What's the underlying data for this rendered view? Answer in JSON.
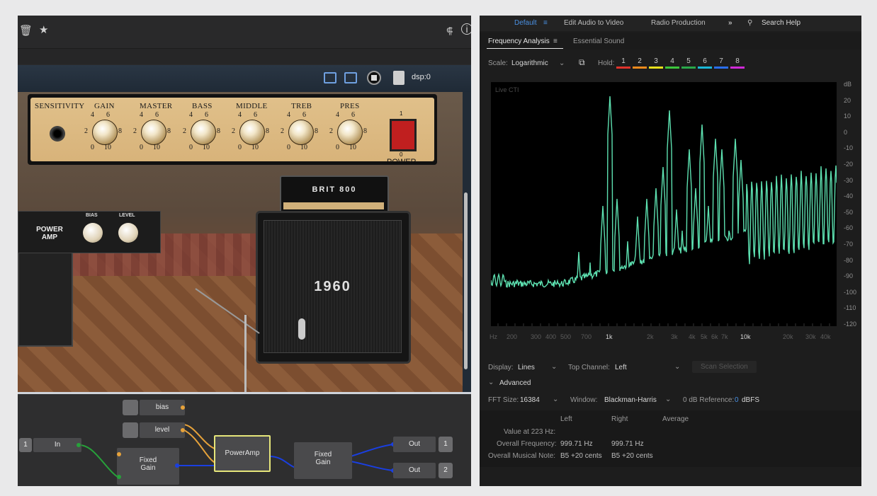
{
  "left": {
    "plugin": {
      "dsp_label": "dsp:0"
    },
    "amp": {
      "knob_labels": [
        "SENSITIVITY",
        "GAIN",
        "MASTER",
        "BASS",
        "MIDDLE",
        "TREB",
        "PRES"
      ],
      "scale": {
        "low": "0",
        "mid_low": "2",
        "top_left": "4",
        "top_right": "6",
        "mid_high": "8",
        "high": "10"
      },
      "power_label": "POWER",
      "power_on": "1",
      "power_off": "0"
    },
    "brit_label": "BRIT 800",
    "cab_label": "1960",
    "power_amp": {
      "title_line1": "POWER",
      "title_line2": "AMP",
      "bias": "BIAS",
      "level": "LEVEL"
    },
    "graph": {
      "in_label": "In",
      "in_badge": "1",
      "bias_label": "bias",
      "level_label": "level",
      "fixed_gain_1": "Fixed\nGain",
      "poweramp": "PowerAmp",
      "fixed_gain_2": "Fixed\nGain",
      "out1_label": "Out",
      "out1_badge": "1",
      "out2_label": "Out",
      "out2_badge": "2"
    }
  },
  "right": {
    "workspaces": [
      "Default",
      "Edit Audio to Video",
      "Radio Production"
    ],
    "search_placeholder": "Search Help",
    "tabs": {
      "active": "Frequency Analysis",
      "other": "Essential Sound"
    },
    "scale_label": "Scale:",
    "scale_value": "Logarithmic",
    "hold_label": "Hold:",
    "hold_slots": [
      {
        "n": "1",
        "color": "#e0332c"
      },
      {
        "n": "2",
        "color": "#f08a1c"
      },
      {
        "n": "3",
        "color": "#e8e01c"
      },
      {
        "n": "4",
        "color": "#3cc63c"
      },
      {
        "n": "5",
        "color": "#2aa84a"
      },
      {
        "n": "6",
        "color": "#1ab8d8"
      },
      {
        "n": "7",
        "color": "#2a6ef0"
      },
      {
        "n": "8",
        "color": "#d02ad8"
      }
    ],
    "graph_title": "Live CTI",
    "db_labels": [
      "dB",
      "20",
      "10",
      "0",
      "-10",
      "-20",
      "-30",
      "-40",
      "-50",
      "-60",
      "-70",
      "-80",
      "-90",
      "-100",
      "-110",
      "-120"
    ],
    "freq_labels": [
      {
        "t": "Hz",
        "bright": false
      },
      {
        "t": "200",
        "bright": false
      },
      {
        "t": "300",
        "bright": false
      },
      {
        "t": "400",
        "bright": false
      },
      {
        "t": "500",
        "bright": false
      },
      {
        "t": "700",
        "bright": false
      },
      {
        "t": "1k",
        "bright": true
      },
      {
        "t": "2k",
        "bright": false
      },
      {
        "t": "3k",
        "bright": false
      },
      {
        "t": "4k",
        "bright": false
      },
      {
        "t": "5k",
        "bright": false
      },
      {
        "t": "6k",
        "bright": false
      },
      {
        "t": "7k",
        "bright": false
      },
      {
        "t": "10k",
        "bright": true
      },
      {
        "t": "20k",
        "bright": false
      },
      {
        "t": "30k",
        "bright": false
      },
      {
        "t": "40k",
        "bright": false
      }
    ],
    "display_label": "Display:",
    "display_value": "Lines",
    "top_channel_label": "Top Channel:",
    "top_channel_value": "Left",
    "scan_selection": "Scan Selection",
    "advanced": "Advanced",
    "fft_label": "FFT Size:",
    "fft_value": "16384",
    "window_label": "Window:",
    "window_value": "Blackman-Harris",
    "ref_label": "0 dB Reference:",
    "ref_value_num": "0",
    "ref_value_unit": "dBFS",
    "info": {
      "headers": [
        "Left",
        "Right",
        "Average"
      ],
      "rows": [
        {
          "label": "Value at 223 Hz:",
          "left": "",
          "right": ""
        },
        {
          "label": "Overall Frequency:",
          "left": "999.71 Hz",
          "right": "999.71 Hz"
        },
        {
          "label": "Overall Musical Note:",
          "left": "B5 +20 cents",
          "right": "B5 +20 cents"
        }
      ]
    },
    "spectrum_color": "#5de0b0"
  }
}
